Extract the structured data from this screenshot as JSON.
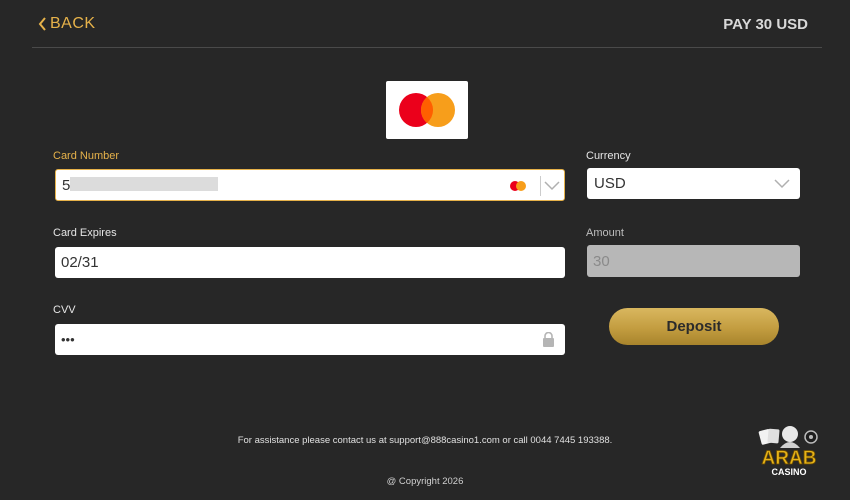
{
  "header": {
    "back_label": "BACK",
    "pay_label": "PAY 30 USD"
  },
  "payment_logo": "mastercard-logo",
  "form": {
    "card_number": {
      "label": "Card Number",
      "value": "5",
      "masked": true,
      "icon": "mastercard-icon"
    },
    "card_expires": {
      "label": "Card Expires",
      "value": "02/31"
    },
    "cvv": {
      "label": "CVV",
      "value": "•••",
      "icon": "lock-icon"
    },
    "currency": {
      "label": "Currency",
      "value": "USD"
    },
    "amount": {
      "label": "Amount",
      "value": "30",
      "disabled": true
    },
    "deposit_label": "Deposit"
  },
  "footer": {
    "assistance": "For assistance please contact us at support@888casino1.com or call 0044 7445 193388.",
    "copyright": "@ Copyright 2026"
  },
  "brand": {
    "line1": "ARAB",
    "line2": "CASINO"
  },
  "colors": {
    "background": "#272727",
    "accent_gold": "#e6b24a",
    "button_gold": "#c9a54a",
    "mastercard_red": "#eb001b",
    "mastercard_orange": "#f79e1b"
  }
}
